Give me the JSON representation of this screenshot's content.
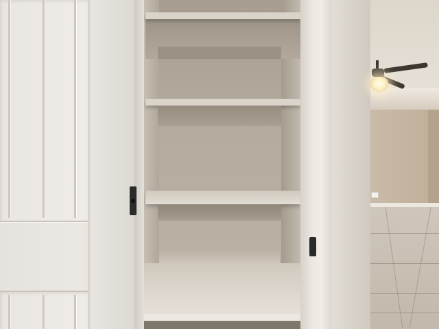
{
  "scene": {
    "subject": "open-closet-with-shelves",
    "colors": {
      "door": "#e9e6e1",
      "closet_interior": "#b5ab9e",
      "shelf": "#d9d3ca",
      "trim": "#f0ede8",
      "room_wall": "#c4b4a0",
      "floor_tile": "#c8beb1",
      "hardware": "#2b2b2b"
    },
    "icons": [
      "door-hinge-icon",
      "latch-strike-icon",
      "ceiling-fan-icon"
    ]
  }
}
